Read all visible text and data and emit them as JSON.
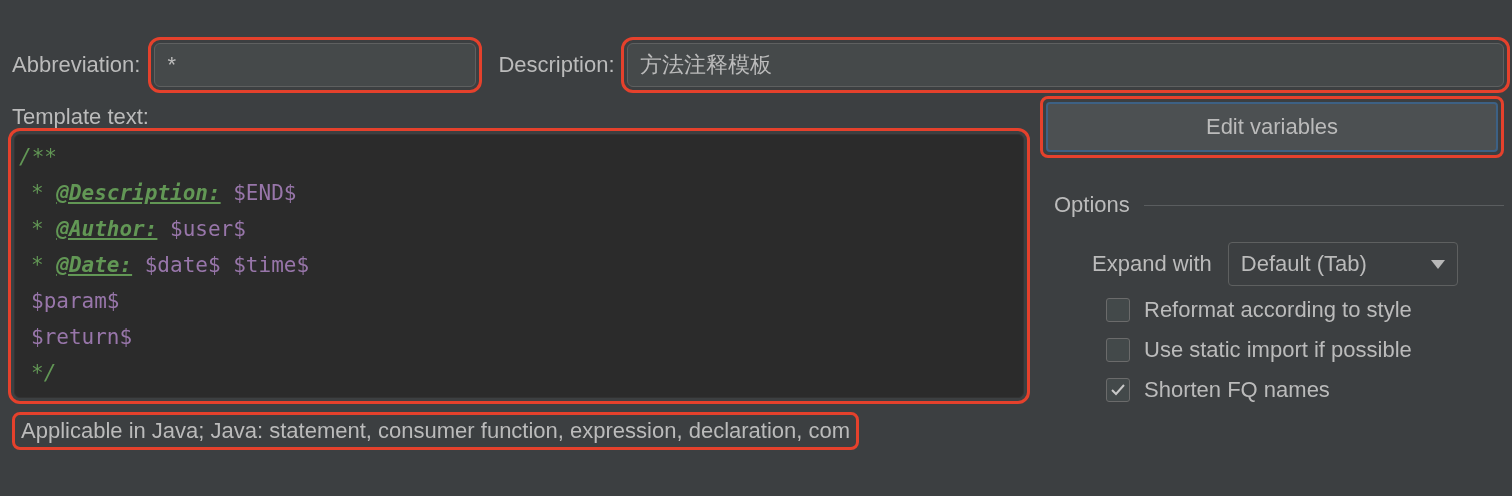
{
  "abbreviation": {
    "label": "Abbreviation:",
    "value": "*",
    "highlighted": true
  },
  "description": {
    "label": "Description:",
    "value": "方法注释模板",
    "highlighted": true
  },
  "template": {
    "label": "Template text:",
    "highlighted": true,
    "lines": [
      [
        {
          "kind": "comment",
          "text": "/**"
        }
      ],
      [
        {
          "kind": "comment",
          "text": "*"
        },
        {
          "kind": "tag",
          "text": "@Description:"
        },
        {
          "kind": "variable",
          "text": "$END$"
        }
      ],
      [
        {
          "kind": "comment",
          "text": "*"
        },
        {
          "kind": "tag",
          "text": "@Author:"
        },
        {
          "kind": "variable",
          "text": "$user$"
        }
      ],
      [
        {
          "kind": "comment",
          "text": "*"
        },
        {
          "kind": "tag",
          "text": "@Date:"
        },
        {
          "kind": "variable",
          "text": "$date$ $time$"
        }
      ],
      [
        {
          "kind": "variable",
          "text": "$param$"
        }
      ],
      [
        {
          "kind": "variable",
          "text": "$return$"
        }
      ],
      [
        {
          "kind": "comment",
          "text": "*/"
        }
      ]
    ]
  },
  "edit_variables": {
    "label": "Edit variables",
    "highlighted": true
  },
  "options": {
    "title": "Options",
    "expand_label": "Expand with",
    "expand_value": "Default (Tab)",
    "checkboxes": [
      {
        "label": "Reformat according to style",
        "checked": false
      },
      {
        "label": "Use static import if possible",
        "checked": false
      },
      {
        "label": "Shorten FQ names",
        "checked": true
      }
    ]
  },
  "applicable": {
    "text": "Applicable in Java; Java: statement, consumer function, expression, declaration, com",
    "highlighted": true
  }
}
